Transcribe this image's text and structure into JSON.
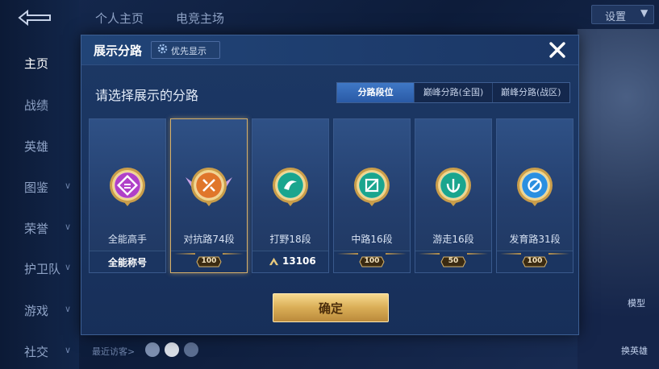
{
  "background": {
    "top_tabs": [
      "个人主页",
      "电竞主场"
    ],
    "settings_label": "设置",
    "nav": [
      {
        "label": "主页",
        "active": true,
        "has_chevron": false
      },
      {
        "label": "战绩",
        "active": false,
        "has_chevron": false
      },
      {
        "label": "英雄",
        "active": false,
        "has_chevron": false
      },
      {
        "label": "图鉴",
        "active": false,
        "has_chevron": true
      },
      {
        "label": "荣誉",
        "active": false,
        "has_chevron": true
      },
      {
        "label": "护卫队",
        "active": false,
        "has_chevron": true
      },
      {
        "label": "游戏",
        "active": false,
        "has_chevron": true
      },
      {
        "label": "社交",
        "active": false,
        "has_chevron": true
      }
    ],
    "visitors_label": "最近访客>",
    "right_buttons": [
      "模型",
      "换英雄"
    ]
  },
  "modal": {
    "title": "展示分路",
    "priority_label": "优先显示",
    "close_icon": "close-icon",
    "subtitle": "请选择展示的分路",
    "tabs": [
      {
        "label": "分路段位",
        "active": true
      },
      {
        "label": "巅峰分路(全国)",
        "active": false
      },
      {
        "label": "巅峰分路(战区)",
        "active": false
      }
    ],
    "cards": [
      {
        "label": "全能高手",
        "footer": "全能称号",
        "footer_type": "text",
        "selected": false,
        "icon": "all-round-emblem",
        "color": "#b040c8"
      },
      {
        "label": "对抗路74段",
        "footer": "100",
        "footer_type": "rank",
        "selected": true,
        "icon": "clash-lane-emblem",
        "color": "#e0762a"
      },
      {
        "label": "打野18段",
        "footer": "13106",
        "footer_type": "peak",
        "selected": false,
        "icon": "jungle-emblem",
        "color": "#1aa58e"
      },
      {
        "label": "中路16段",
        "footer": "100",
        "footer_type": "rank",
        "selected": false,
        "icon": "mid-lane-emblem",
        "color": "#1aa58e"
      },
      {
        "label": "游走16段",
        "footer": "50",
        "footer_type": "rank",
        "selected": false,
        "icon": "roam-emblem",
        "color": "#1aa58e"
      },
      {
        "label": "发育路31段",
        "footer": "100",
        "footer_type": "rank",
        "selected": false,
        "icon": "farm-lane-emblem",
        "color": "#2b8fe0"
      }
    ],
    "confirm_label": "确定"
  },
  "colors": {
    "accent_gold": "#d9ad56",
    "tab_active": "#3f78c6",
    "panel": "#1c3864"
  }
}
